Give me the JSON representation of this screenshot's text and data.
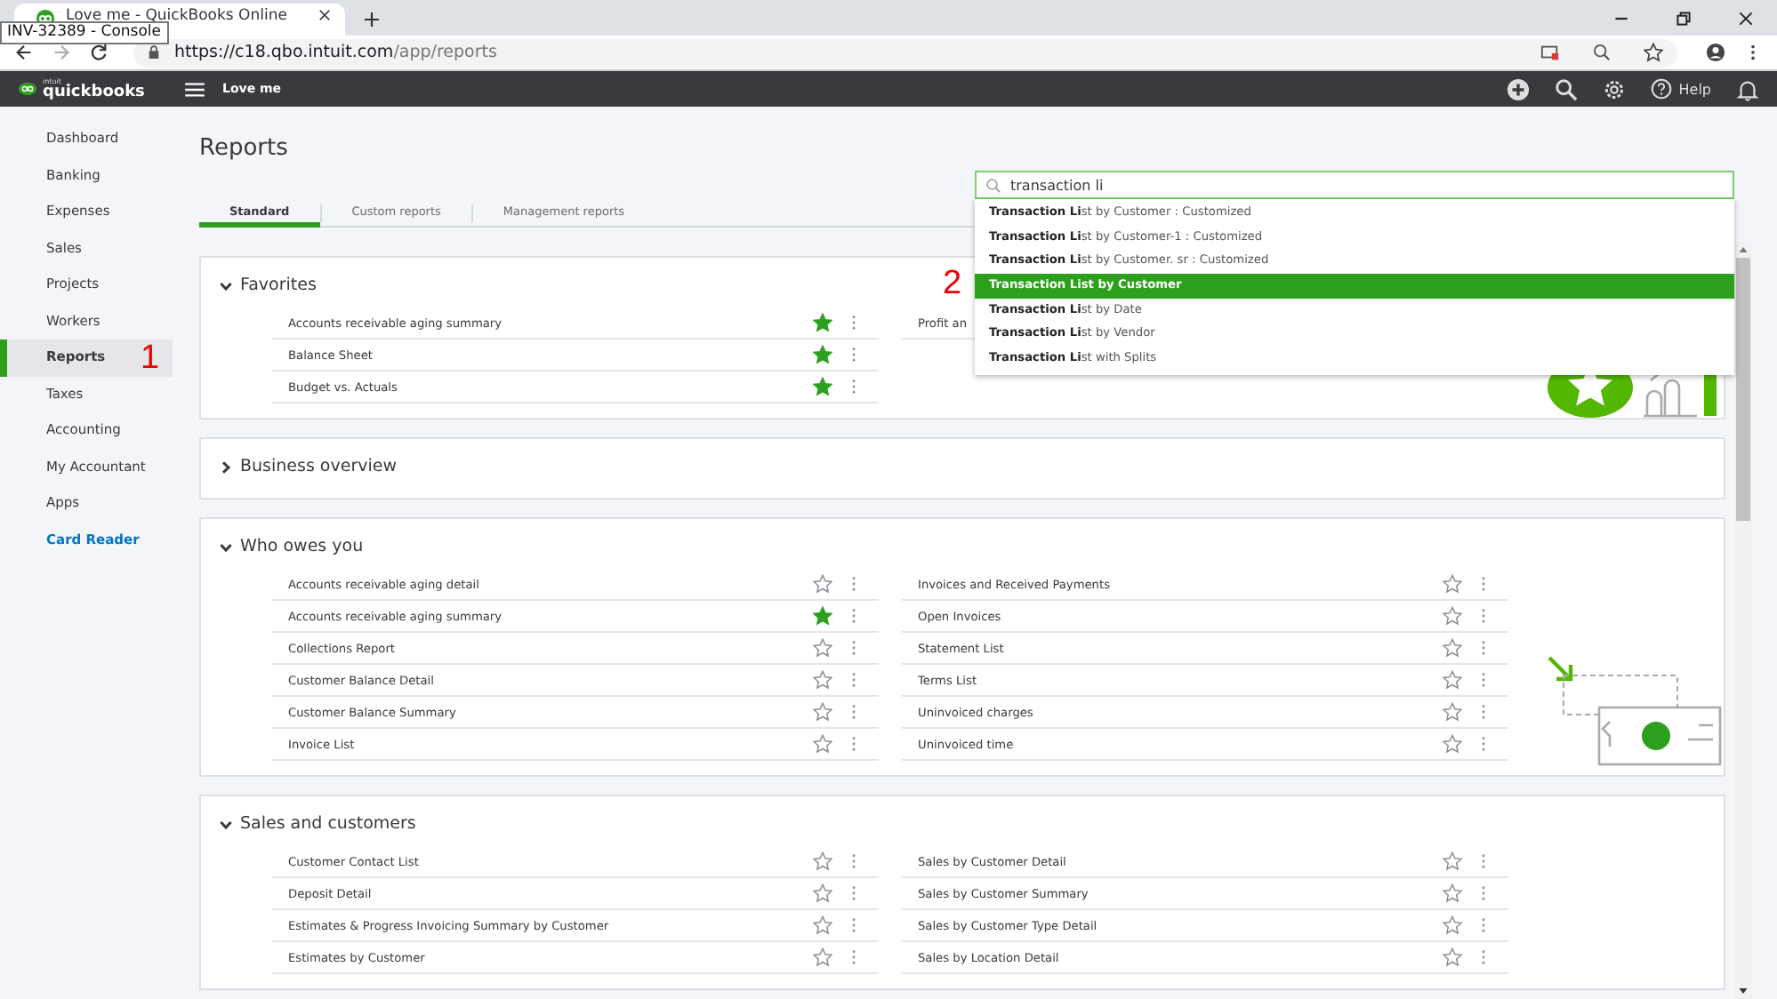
{
  "browser": {
    "tab_title": "Love me - QuickBooks Online",
    "tooltip": "INV-32389 - Console",
    "url_host": "https://c18.qbo.intuit.com",
    "url_path": "/app/reports"
  },
  "app_header": {
    "logo_brand": "intuit",
    "logo_product": "quickbooks",
    "company": "Love me",
    "help": "Help"
  },
  "sidebar": {
    "items": [
      {
        "label": "Dashboard",
        "selected": false,
        "kind": "nav"
      },
      {
        "label": "Banking",
        "selected": false,
        "kind": "nav"
      },
      {
        "label": "Expenses",
        "selected": false,
        "kind": "nav"
      },
      {
        "label": "Sales",
        "selected": false,
        "kind": "nav"
      },
      {
        "label": "Projects",
        "selected": false,
        "kind": "nav"
      },
      {
        "label": "Workers",
        "selected": false,
        "kind": "nav"
      },
      {
        "label": "Reports",
        "selected": true,
        "kind": "nav",
        "annotation": "1"
      },
      {
        "label": "Taxes",
        "selected": false,
        "kind": "nav"
      },
      {
        "label": "Accounting",
        "selected": false,
        "kind": "nav"
      },
      {
        "label": "My Accountant",
        "selected": false,
        "kind": "nav"
      },
      {
        "label": "Apps",
        "selected": false,
        "kind": "nav"
      },
      {
        "label": "Card Reader",
        "selected": false,
        "kind": "link"
      }
    ]
  },
  "page_title": "Reports",
  "tabs": [
    {
      "label": "Standard",
      "selected": true
    },
    {
      "label": "Custom reports",
      "selected": false
    },
    {
      "label": "Management reports",
      "selected": false
    }
  ],
  "search": {
    "value": "transaction li",
    "annotation": "2",
    "suggestions": [
      {
        "label": "**Transaction Li**st by Customer : Customized",
        "selected": false
      },
      {
        "label": "**Transaction Li**st by Customer-1 : Customized",
        "selected": false
      },
      {
        "label": "**Transaction Li**st by Customer. sr : Customized",
        "selected": false
      },
      {
        "label": "**Transaction Li**st by Customer",
        "selected": true
      },
      {
        "label": "**Transaction Li**st by Date",
        "selected": false
      },
      {
        "label": "**Transaction Li**st by Vendor",
        "selected": false
      },
      {
        "label": "**Transaction Li**st with Splits",
        "selected": false
      }
    ]
  },
  "sections": [
    {
      "title": "Favorites",
      "expanded": true,
      "kind": "favorites",
      "columns": [
        [
          {
            "name": "Accounts receivable aging summary",
            "favorite": true
          },
          {
            "name": "Balance Sheet",
            "favorite": true
          },
          {
            "name": "Budget vs. Actuals",
            "favorite": true
          }
        ],
        [
          {
            "name": "Profit an"
          }
        ]
      ]
    },
    {
      "title": "Business overview",
      "expanded": false
    },
    {
      "title": "Who owes you",
      "expanded": true,
      "kind": "receivables",
      "columns": [
        [
          {
            "name": "Accounts receivable aging detail",
            "favorite": false
          },
          {
            "name": "Accounts receivable aging summary",
            "favorite": true
          },
          {
            "name": "Collections Report",
            "favorite": false
          },
          {
            "name": "Customer Balance Detail",
            "favorite": false
          },
          {
            "name": "Customer Balance Summary",
            "favorite": false
          },
          {
            "name": "Invoice List",
            "favorite": false
          }
        ],
        [
          {
            "name": "Invoices and Received Payments",
            "favorite": false
          },
          {
            "name": "Open Invoices",
            "favorite": false
          },
          {
            "name": "Statement List",
            "favorite": false
          },
          {
            "name": "Terms List",
            "favorite": false
          },
          {
            "name": "Uninvoiced charges",
            "favorite": false
          },
          {
            "name": "Uninvoiced time",
            "favorite": false
          }
        ]
      ]
    },
    {
      "title": "Sales and customers",
      "expanded": true,
      "columns": [
        [
          {
            "name": "Customer Contact List",
            "favorite": false
          },
          {
            "name": "Deposit Detail",
            "favorite": false
          },
          {
            "name": "Estimates & Progress Invoicing Summary by Customer",
            "favorite": false
          },
          {
            "name": "Estimates by Customer",
            "favorite": false
          }
        ],
        [
          {
            "name": "Sales by Customer Detail",
            "favorite": false
          },
          {
            "name": "Sales by Customer Summary",
            "favorite": false
          },
          {
            "name": "Sales by Customer Type Detail",
            "favorite": false
          },
          {
            "name": "Sales by Location Detail",
            "favorite": false
          }
        ]
      ]
    }
  ]
}
